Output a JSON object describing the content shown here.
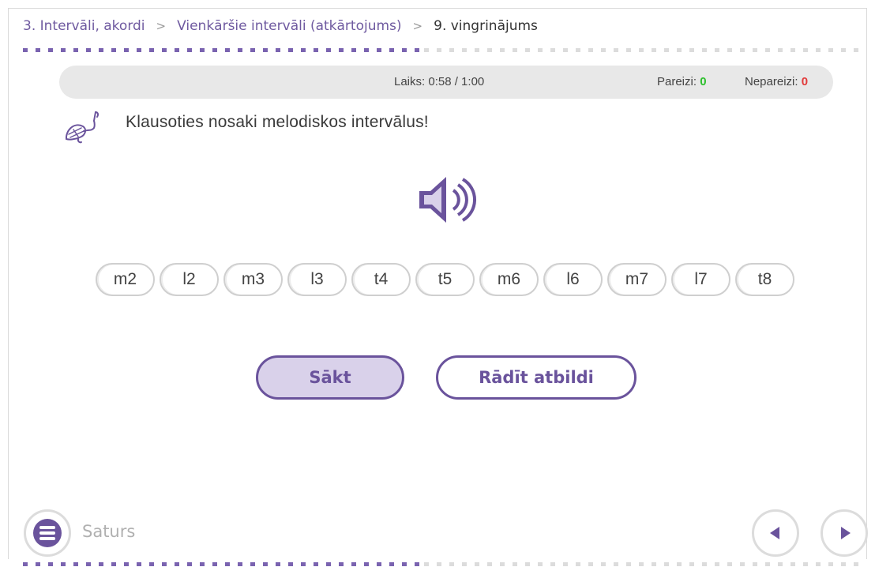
{
  "breadcrumb": {
    "items": [
      "3. Intervāli, akordi",
      "Vienkāršie intervāli (atkārtojums)",
      "9. vingrinājums"
    ],
    "separator": ">"
  },
  "status": {
    "timer_label": "Laiks:",
    "timer_value": "0:58 / 1:00",
    "correct_label": "Pareizi:",
    "correct_count": "0",
    "wrong_label": "Nepareizi:",
    "wrong_count": "0"
  },
  "instruction": {
    "icon": "music-note-icon",
    "text": "Klausoties nosaki melodiskos intervālus!"
  },
  "speaker": {
    "icon": "speaker-icon"
  },
  "intervals": [
    "m2",
    "l2",
    "m3",
    "l3",
    "t4",
    "t5",
    "m6",
    "l6",
    "m7",
    "l7",
    "t8"
  ],
  "buttons": {
    "start": "Sākt",
    "show_answer": "Rādīt atbildi"
  },
  "footer": {
    "menu_icon": "menu-icon",
    "contents_label": "Saturs",
    "prev_icon": "arrow-left-icon",
    "next_icon": "arrow-right-icon"
  },
  "progress": {
    "fraction_done": 0.47
  },
  "colors": {
    "accent": "#6a539c",
    "accent_light": "#d9d1ea",
    "correct": "#2bbf2b",
    "wrong": "#e23a3a"
  }
}
